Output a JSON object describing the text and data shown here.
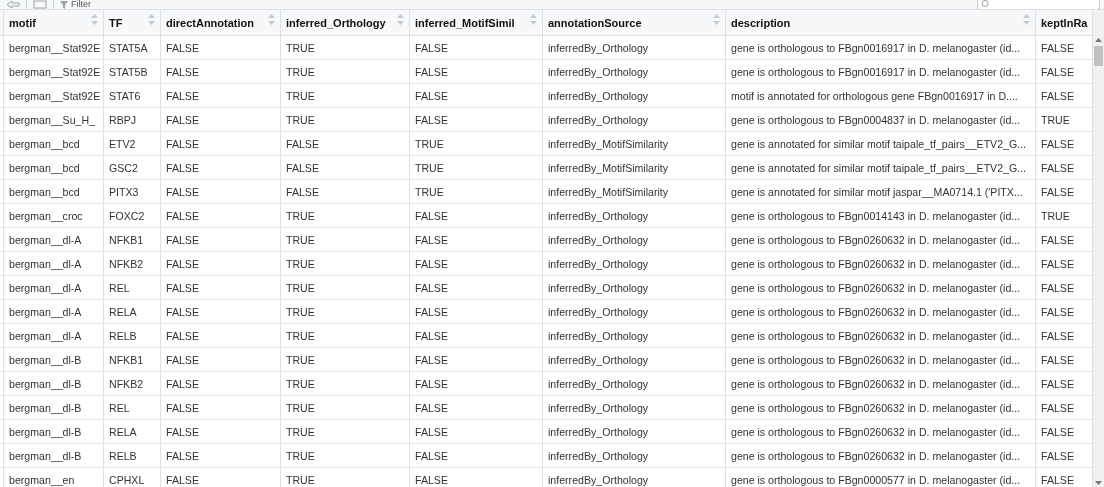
{
  "toolbar": {
    "filter_label": "Filter"
  },
  "table": {
    "columns": [
      {
        "label": "motif",
        "sortable": true
      },
      {
        "label": "TF",
        "sortable": true
      },
      {
        "label": "directAnnotation",
        "sortable": true
      },
      {
        "label": "inferred_Orthology",
        "sortable": true
      },
      {
        "label": "inferred_MotifSimil",
        "sortable": true
      },
      {
        "label": "annotationSource",
        "sortable": true
      },
      {
        "label": "description",
        "sortable": true
      },
      {
        "label": "keptInRa",
        "sortable": false
      }
    ],
    "rows": [
      [
        "bergman__Stat92E",
        "STAT5A",
        "FALSE",
        "TRUE",
        "FALSE",
        "inferredBy_Orthology",
        "gene is orthologous to FBgn0016917 in D. melanogaster (id...",
        "FALSE"
      ],
      [
        "bergman__Stat92E",
        "STAT5B",
        "FALSE",
        "TRUE",
        "FALSE",
        "inferredBy_Orthology",
        "gene is orthologous to FBgn0016917 in D. melanogaster (id...",
        "FALSE"
      ],
      [
        "bergman__Stat92E",
        "STAT6",
        "FALSE",
        "TRUE",
        "FALSE",
        "inferredBy_Orthology",
        "motif is annotated for orthologous gene FBgn0016917 in D....",
        "FALSE"
      ],
      [
        "bergman__Su_H_",
        "RBPJ",
        "FALSE",
        "TRUE",
        "FALSE",
        "inferredBy_Orthology",
        "gene is orthologous to FBgn0004837 in D. melanogaster (id...",
        "TRUE"
      ],
      [
        "bergman__bcd",
        "ETV2",
        "FALSE",
        "FALSE",
        "TRUE",
        "inferredBy_MotifSimilarity",
        "gene is annotated for similar motif taipale_tf_pairs__ETV2_G...",
        "FALSE"
      ],
      [
        "bergman__bcd",
        "GSC2",
        "FALSE",
        "FALSE",
        "TRUE",
        "inferredBy_MotifSimilarity",
        "gene is annotated for similar motif taipale_tf_pairs__ETV2_G...",
        "FALSE"
      ],
      [
        "bergman__bcd",
        "PITX3",
        "FALSE",
        "FALSE",
        "TRUE",
        "inferredBy_MotifSimilarity",
        "gene is annotated for similar motif jaspar__MA0714.1 ('PITX...",
        "FALSE"
      ],
      [
        "bergman__croc",
        "FOXC2",
        "FALSE",
        "TRUE",
        "FALSE",
        "inferredBy_Orthology",
        "gene is orthologous to FBgn0014143 in D. melanogaster (id...",
        "TRUE"
      ],
      [
        "bergman__dl-A",
        "NFKB1",
        "FALSE",
        "TRUE",
        "FALSE",
        "inferredBy_Orthology",
        "gene is orthologous to FBgn0260632 in D. melanogaster (id...",
        "FALSE"
      ],
      [
        "bergman__dl-A",
        "NFKB2",
        "FALSE",
        "TRUE",
        "FALSE",
        "inferredBy_Orthology",
        "gene is orthologous to FBgn0260632 in D. melanogaster (id...",
        "FALSE"
      ],
      [
        "bergman__dl-A",
        "REL",
        "FALSE",
        "TRUE",
        "FALSE",
        "inferredBy_Orthology",
        "gene is orthologous to FBgn0260632 in D. melanogaster (id...",
        "FALSE"
      ],
      [
        "bergman__dl-A",
        "RELA",
        "FALSE",
        "TRUE",
        "FALSE",
        "inferredBy_Orthology",
        "gene is orthologous to FBgn0260632 in D. melanogaster (id...",
        "FALSE"
      ],
      [
        "bergman__dl-A",
        "RELB",
        "FALSE",
        "TRUE",
        "FALSE",
        "inferredBy_Orthology",
        "gene is orthologous to FBgn0260632 in D. melanogaster (id...",
        "FALSE"
      ],
      [
        "bergman__dl-B",
        "NFKB1",
        "FALSE",
        "TRUE",
        "FALSE",
        "inferredBy_Orthology",
        "gene is orthologous to FBgn0260632 in D. melanogaster (id...",
        "FALSE"
      ],
      [
        "bergman__dl-B",
        "NFKB2",
        "FALSE",
        "TRUE",
        "FALSE",
        "inferredBy_Orthology",
        "gene is orthologous to FBgn0260632 in D. melanogaster (id...",
        "FALSE"
      ],
      [
        "bergman__dl-B",
        "REL",
        "FALSE",
        "TRUE",
        "FALSE",
        "inferredBy_Orthology",
        "gene is orthologous to FBgn0260632 in D. melanogaster (id...",
        "FALSE"
      ],
      [
        "bergman__dl-B",
        "RELA",
        "FALSE",
        "TRUE",
        "FALSE",
        "inferredBy_Orthology",
        "gene is orthologous to FBgn0260632 in D. melanogaster (id...",
        "FALSE"
      ],
      [
        "bergman__dl-B",
        "RELB",
        "FALSE",
        "TRUE",
        "FALSE",
        "inferredBy_Orthology",
        "gene is orthologous to FBgn0260632 in D. melanogaster (id...",
        "FALSE"
      ],
      [
        "bergman__en",
        "CPHXL",
        "FALSE",
        "TRUE",
        "FALSE",
        "inferredBy_Orthology",
        "gene is orthologous to FBgn0000577 in D. melanogaster (id...",
        "FALSE"
      ]
    ]
  }
}
